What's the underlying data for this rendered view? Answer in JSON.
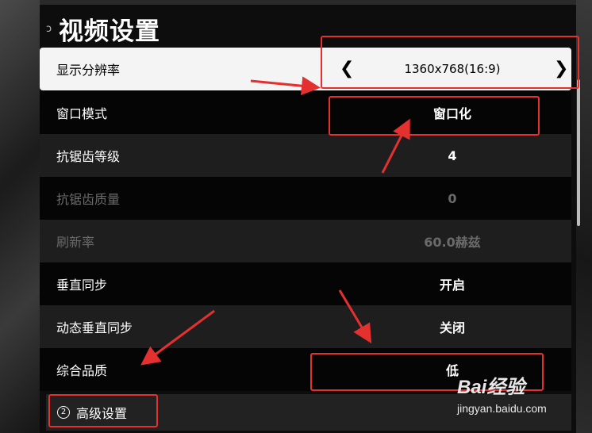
{
  "header": {
    "title": "视频设置",
    "back_icon": "back-icon"
  },
  "rows": [
    {
      "label": "显示分辨率",
      "value": "1360x768(16:9)",
      "state": "selected"
    },
    {
      "label": "窗口模式",
      "value": "窗口化",
      "state": "normal"
    },
    {
      "label": "抗锯齿等级",
      "value": "4",
      "state": "normal"
    },
    {
      "label": "抗锯齿质量",
      "value": "0",
      "state": "disabled"
    },
    {
      "label": "刷新率",
      "value": "60.0赫兹",
      "state": "disabled"
    },
    {
      "label": "垂直同步",
      "value": "开启",
      "state": "normal"
    },
    {
      "label": "动态垂直同步",
      "value": "关闭",
      "state": "normal"
    },
    {
      "label": "综合品质",
      "value": "低",
      "state": "normal"
    }
  ],
  "advanced": {
    "label": "高级设置",
    "icon_text": "2"
  },
  "arrows": {
    "left": "❮",
    "right": "❯"
  },
  "watermark": {
    "logo": "Bai经验",
    "url": "jingyan.baidu.com"
  },
  "colors": {
    "annotation": "#e53030",
    "selected_bg": "#f4f4f4",
    "row_dark": "#050505",
    "row_gray": "#1e1e1e"
  }
}
